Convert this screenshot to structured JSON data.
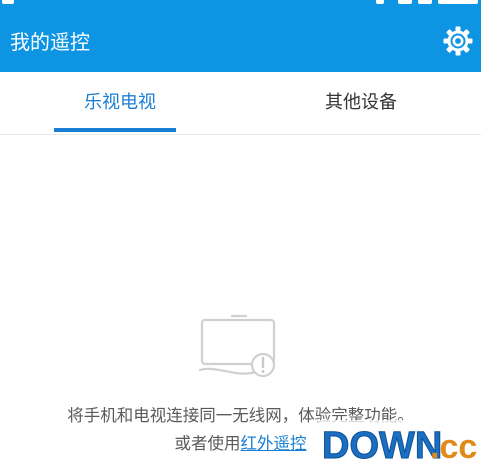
{
  "appbar": {
    "title": "我的遥控",
    "settings_icon": "gear-icon",
    "background": "#0d95e4"
  },
  "tabs": [
    {
      "label": "乐视电视",
      "active": true
    },
    {
      "label": "其他设备",
      "active": false
    }
  ],
  "accent": "#1a7fd4",
  "empty_state": {
    "icon": "tv-disconnected-icon",
    "message": "将手机和电视连接同一无线网，体验完整功能。",
    "alt_prefix": "或者使用",
    "alt_link": "红外遥控"
  },
  "watermark": {
    "text_main": "DOWN",
    "text_suffix": ".cc"
  }
}
